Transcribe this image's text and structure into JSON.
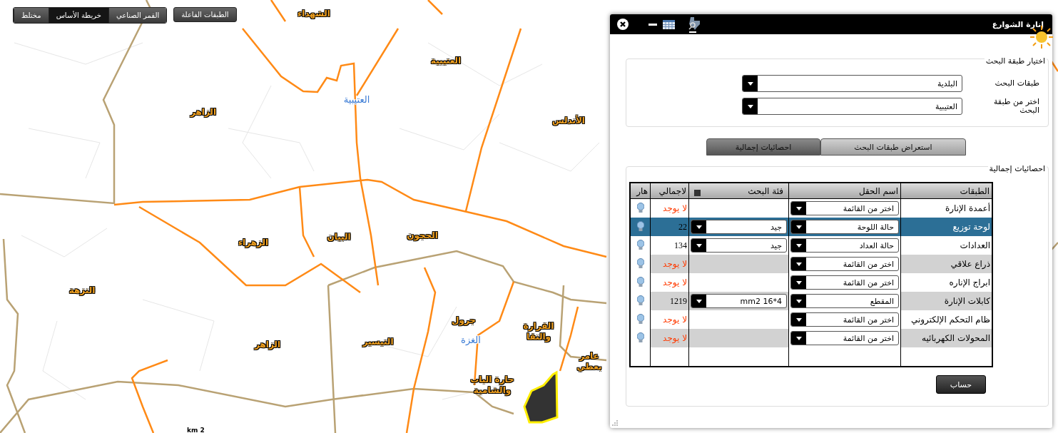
{
  "map_toolbar": {
    "layers_button": "الطبقات الفاعلة",
    "basemaps": [
      {
        "label": "القمر الصناعي",
        "selected": false
      },
      {
        "label": "خريطة الأساس",
        "selected": true
      },
      {
        "label": "مختلط",
        "selected": false
      }
    ]
  },
  "map_labels": [
    {
      "text": "الشهداء",
      "kind": "district"
    },
    {
      "text": "العتيبية",
      "kind": "district"
    },
    {
      "text": "الزاهر",
      "kind": "district"
    },
    {
      "text": "العتيبية",
      "kind": "area"
    },
    {
      "text": "الأندلس",
      "kind": "district"
    },
    {
      "text": "الزهراء",
      "kind": "district"
    },
    {
      "text": "البيان",
      "kind": "district"
    },
    {
      "text": "الحجون",
      "kind": "district"
    },
    {
      "text": "النزهة",
      "kind": "district"
    },
    {
      "text": "التيسير",
      "kind": "district"
    },
    {
      "text": "الزاهر",
      "kind": "district"
    },
    {
      "text": "القرارة والنقا",
      "kind": "district"
    },
    {
      "text": "جرول",
      "kind": "district"
    },
    {
      "text": "الغزة",
      "kind": "area"
    },
    {
      "text": "حارة الباب والشامية",
      "kind": "district"
    },
    {
      "text": "عامر بعطي",
      "kind": "district"
    }
  ],
  "scale_label": "km 2",
  "panel": {
    "title": "إنارة الشوارع",
    "search_layer": {
      "legend": "اختيار طبقة البحث",
      "fields": [
        {
          "label": "طبقات البحث",
          "value": "البلدية"
        },
        {
          "label": "اختر من طبقة البحث",
          "value": "العتيبية"
        }
      ]
    },
    "tabs": [
      {
        "label": "استعراض طبقات البحث",
        "selected": false
      },
      {
        "label": "احصائيات إجمالية",
        "selected": true
      }
    ],
    "stats": {
      "legend": "احصائيات إجمالية",
      "columns": [
        {
          "label": "الطبقات"
        },
        {
          "label": "اسم الحقل"
        },
        {
          "label": "فئة البحث",
          "checkbox": {
            "checked": false
          }
        },
        {
          "label": "لاجمالي"
        },
        {
          "label": "هار"
        }
      ],
      "rows": [
        {
          "layer": "أعمدة الإنارة",
          "field": "اختر من القائمة",
          "total": "لا يوجد",
          "missing": true,
          "selected": false
        },
        {
          "layer": "لوحة توزيع",
          "field": "حالة اللوحة",
          "category": "جيد",
          "total": "22",
          "missing": false,
          "selected": true
        },
        {
          "layer": "العدادات",
          "field": "حالة العداد",
          "category": "جيد",
          "total": "134",
          "missing": false,
          "selected": false
        },
        {
          "layer": "ذراع علاقي",
          "field": "اختر من القائمة",
          "total": "لا يوجد",
          "missing": true,
          "selected": false
        },
        {
          "layer": "ابراج الإناره",
          "field": "اختر من القائمة",
          "total": "لا يوجد",
          "missing": true,
          "selected": false
        },
        {
          "layer": "كابلات الإنارة",
          "field": "المقطع",
          "category": "mm2 16*4",
          "total": "1219",
          "missing": false,
          "selected": false
        },
        {
          "layer": "ظام التحكم الإلكتروني",
          "field": "اختر من القائمة",
          "total": "لا يوجد",
          "missing": true,
          "selected": false
        },
        {
          "layer": "المحولات الكهربائيه",
          "field": "اختر من القائمة",
          "total": "لا يوجد",
          "missing": true,
          "selected": false
        }
      ],
      "button": "حساب"
    }
  }
}
